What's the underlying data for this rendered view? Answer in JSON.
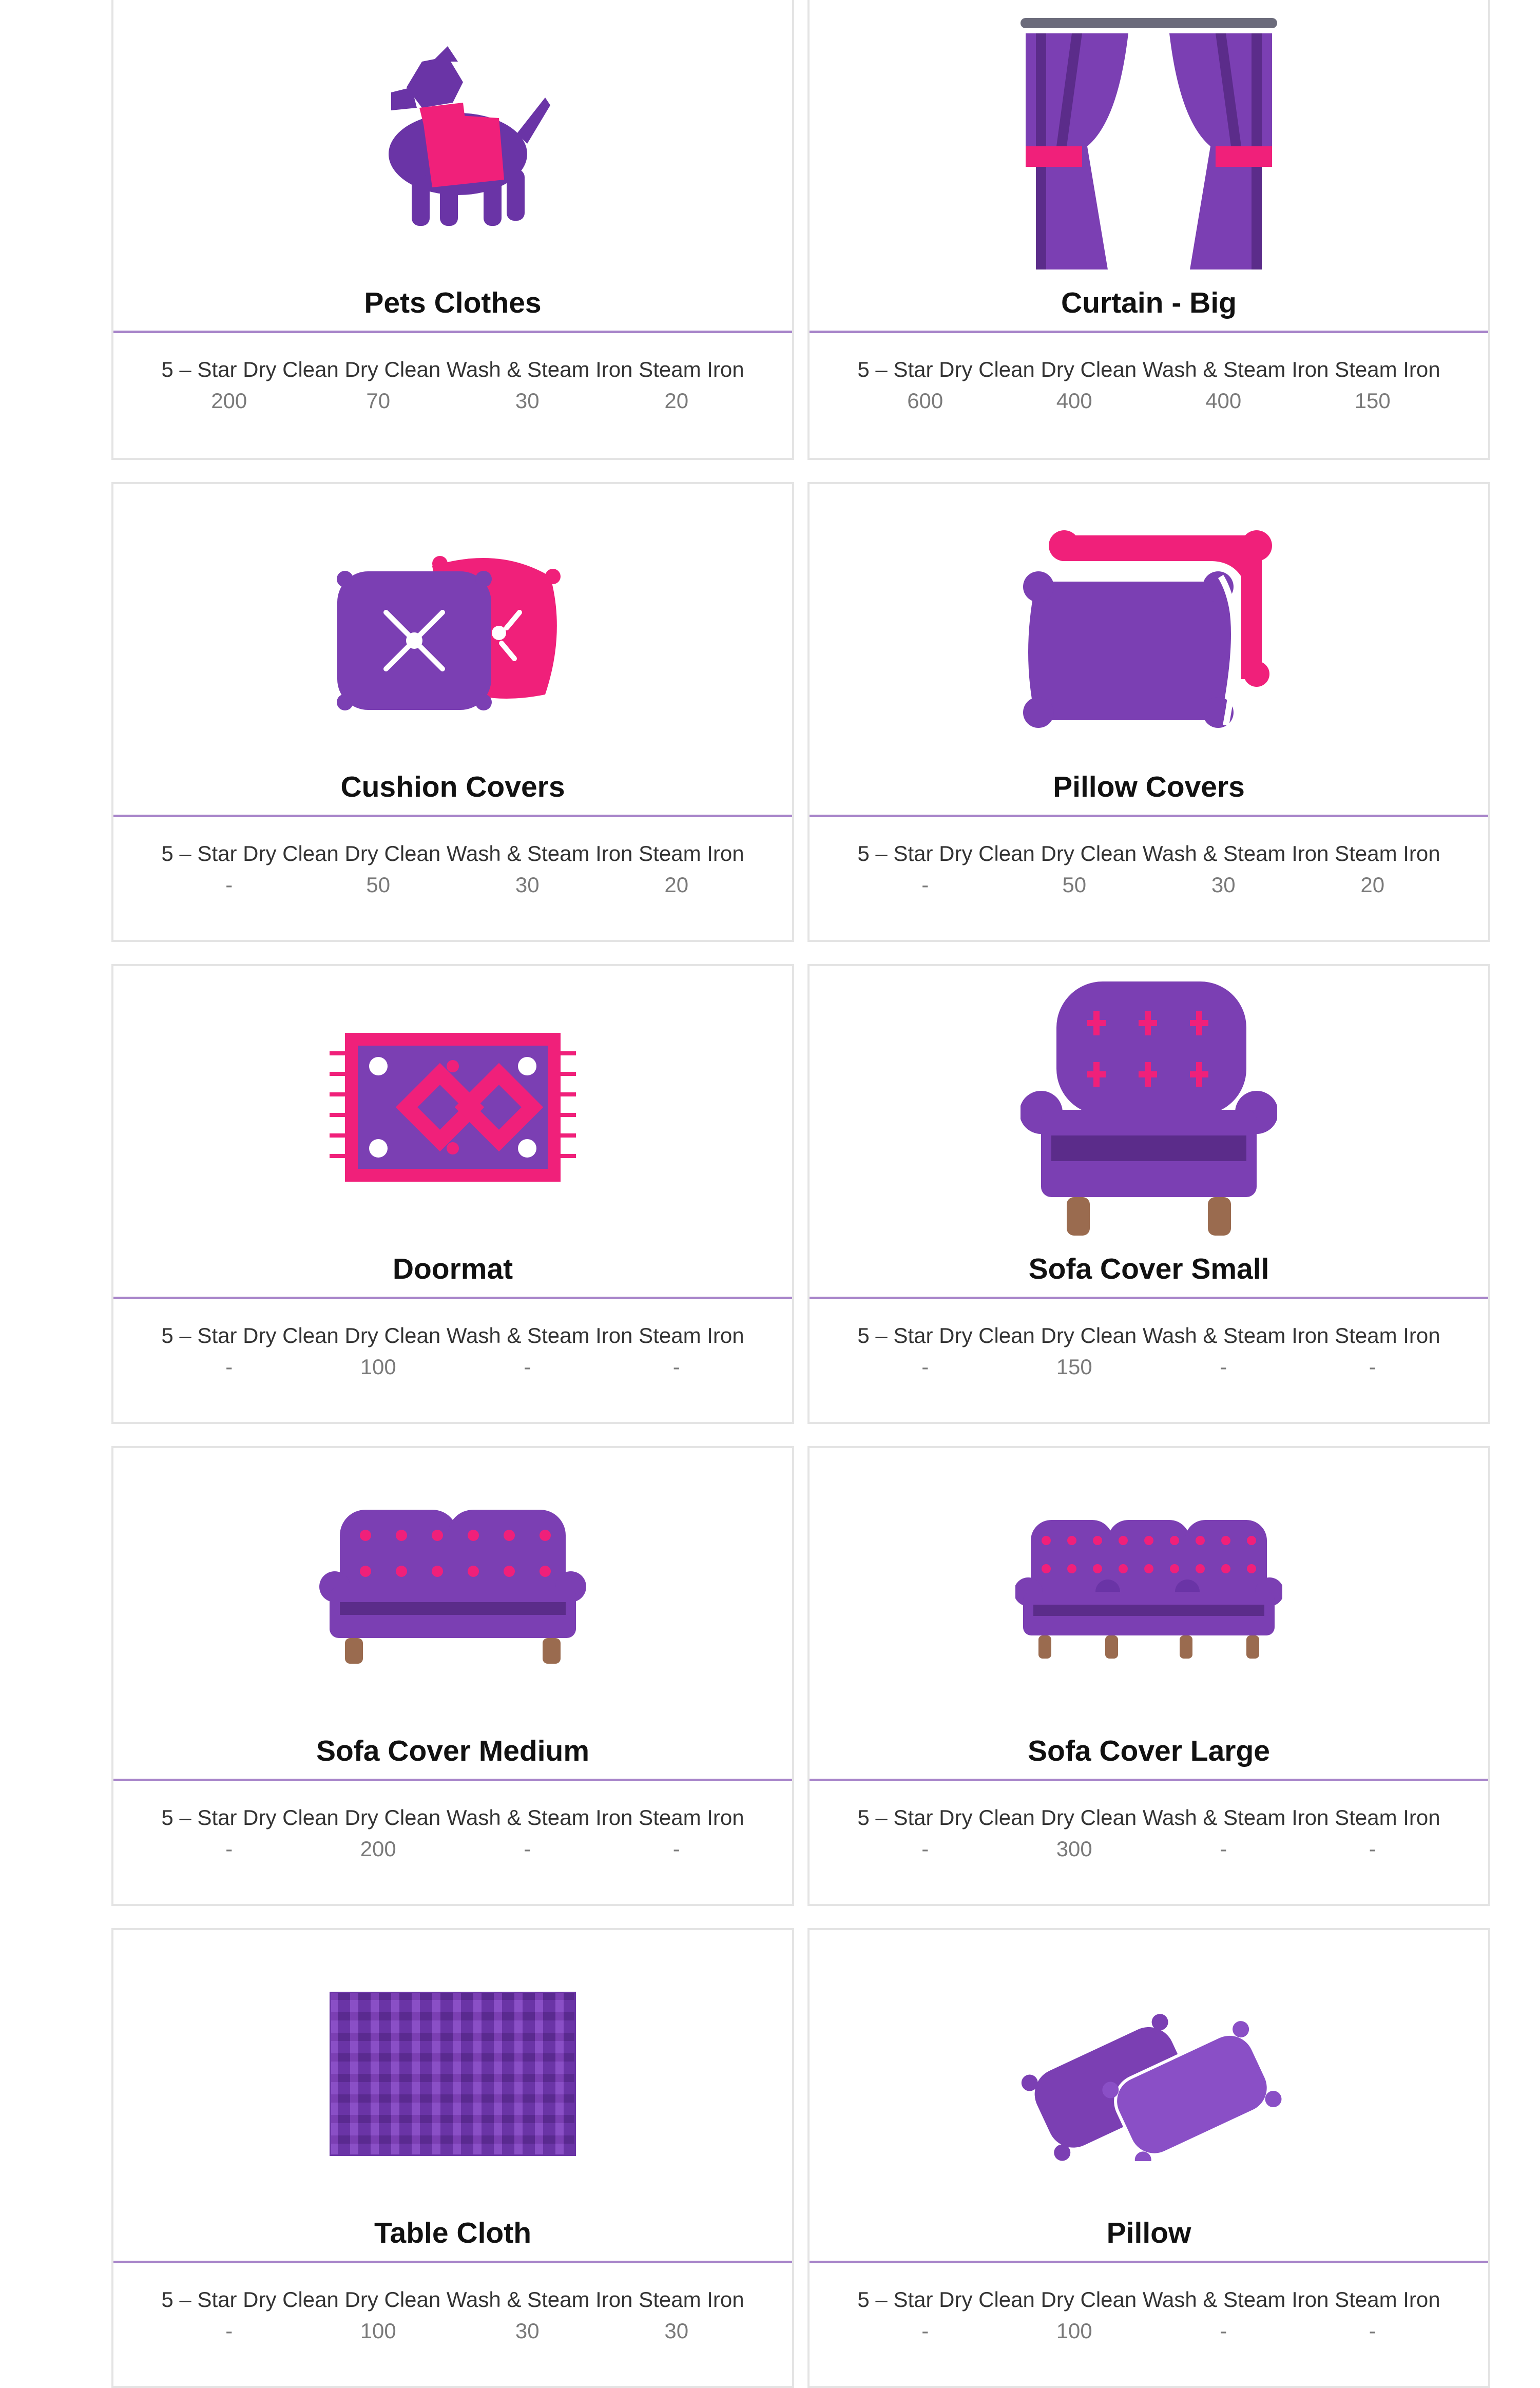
{
  "colors": {
    "purple": "#7b3fb3",
    "dark_purple": "#5b2c8a",
    "pink": "#f0207a",
    "divider": "#a784c9"
  },
  "price_header": "5 – Star Dry Clean Dry Clean Wash & Steam Iron Steam Iron",
  "items": [
    {
      "name": "Pets Clothes",
      "icon": "dog-clothes-icon",
      "prices": [
        "200",
        "70",
        "30",
        "20"
      ]
    },
    {
      "name": "Curtain - Big",
      "icon": "curtain-icon",
      "prices": [
        "600",
        "400",
        "400",
        "150"
      ]
    },
    {
      "name": "Cushion Covers",
      "icon": "cushion-icon",
      "prices": [
        "-",
        "50",
        "30",
        "20"
      ]
    },
    {
      "name": "Pillow Covers",
      "icon": "pillow-cover-icon",
      "prices": [
        "-",
        "50",
        "30",
        "20"
      ]
    },
    {
      "name": "Doormat",
      "icon": "doormat-icon",
      "prices": [
        "-",
        "100",
        "-",
        "-"
      ]
    },
    {
      "name": "Sofa Cover Small",
      "icon": "armchair-icon",
      "prices": [
        "-",
        "150",
        "-",
        "-"
      ]
    },
    {
      "name": "Sofa Cover Medium",
      "icon": "sofa-medium-icon",
      "prices": [
        "-",
        "200",
        "-",
        "-"
      ]
    },
    {
      "name": "Sofa Cover Large",
      "icon": "sofa-large-icon",
      "prices": [
        "-",
        "300",
        "-",
        "-"
      ]
    },
    {
      "name": "Table Cloth",
      "icon": "table-cloth-icon",
      "prices": [
        "-",
        "100",
        "30",
        "30"
      ]
    },
    {
      "name": "Pillow",
      "icon": "pillow-icon",
      "prices": [
        "-",
        "100",
        "-",
        "-"
      ]
    }
  ]
}
